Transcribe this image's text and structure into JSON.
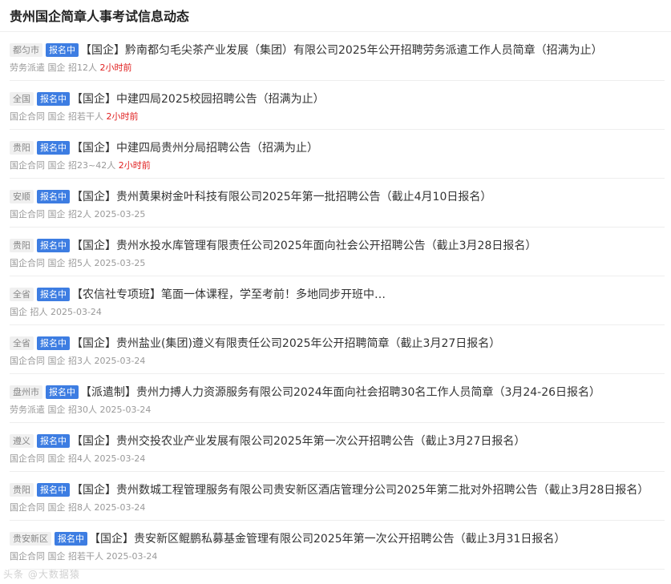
{
  "header": {
    "title": "贵州国企简章人事考试信息动态"
  },
  "items": [
    {
      "region": "都匀市",
      "status": "报名中",
      "title": "【国企】黔南都匀毛尖茶产业发展（集团）有限公司2025年公开招聘劳务派遣工作人员简章（招满为止）",
      "meta": "劳务派遣 国企 招12人",
      "time": "2小时前",
      "recent": true
    },
    {
      "region": "全国",
      "status": "报名中",
      "title": "【国企】中建四局2025校园招聘公告（招满为止）",
      "meta": "国企合同 国企 招若干人",
      "time": "2小时前",
      "recent": true
    },
    {
      "region": "贵阳",
      "status": "报名中",
      "title": "【国企】中建四局贵州分局招聘公告（招满为止）",
      "meta": "国企合同 国企 招23~42人",
      "time": "2小时前",
      "recent": true
    },
    {
      "region": "安顺",
      "status": "报名中",
      "title": "【国企】贵州黄果树金叶科技有限公司2025年第一批招聘公告（截止4月10日报名）",
      "meta": "国企合同 国企 招2人",
      "time": "2025-03-25",
      "recent": false
    },
    {
      "region": "贵阳",
      "status": "报名中",
      "title": "【国企】贵州水投水库管理有限责任公司2025年面向社会公开招聘公告（截止3月28日报名）",
      "meta": "国企合同 国企 招5人",
      "time": "2025-03-25",
      "recent": false
    },
    {
      "region": "全省",
      "status": "报名中",
      "title": "【农信社专项班】笔面一体课程，学至考前！多地同步开班中…",
      "meta": "国企 招人",
      "time": "2025-03-24",
      "recent": false
    },
    {
      "region": "全省",
      "status": "报名中",
      "title": "【国企】贵州盐业(集团)遵义有限责任公司2025年公开招聘简章（截止3月27日报名）",
      "meta": "国企合同 国企 招3人",
      "time": "2025-03-24",
      "recent": false
    },
    {
      "region": "盘州市",
      "status": "报名中",
      "title": "【派遣制】贵州力搏人力资源服务有限公司2024年面向社会招聘30名工作人员简章（3月24-26日报名）",
      "meta": "劳务派遣 国企 招30人",
      "time": "2025-03-24",
      "recent": false
    },
    {
      "region": "遵义",
      "status": "报名中",
      "title": "【国企】贵州交投农业产业发展有限公司2025年第一次公开招聘公告（截止3月27日报名）",
      "meta": "国企合同 国企 招4人",
      "time": "2025-03-24",
      "recent": false
    },
    {
      "region": "贵阳",
      "status": "报名中",
      "title": "【国企】贵州数城工程管理服务有限公司贵安新区酒店管理分公司2025年第二批对外招聘公告（截止3月28日报名）",
      "meta": "国企合同 国企 招8人",
      "time": "2025-03-24",
      "recent": false
    },
    {
      "region": "贵安新区",
      "status": "报名中",
      "title": "【国企】贵安新区鲲鹏私募基金管理有限公司2025年第一次公开招聘公告（截止3月31日报名）",
      "meta": "国企合同 国企 招若干人",
      "time": "2025-03-24",
      "recent": false
    }
  ],
  "watermark": "头条 @大数据猿"
}
